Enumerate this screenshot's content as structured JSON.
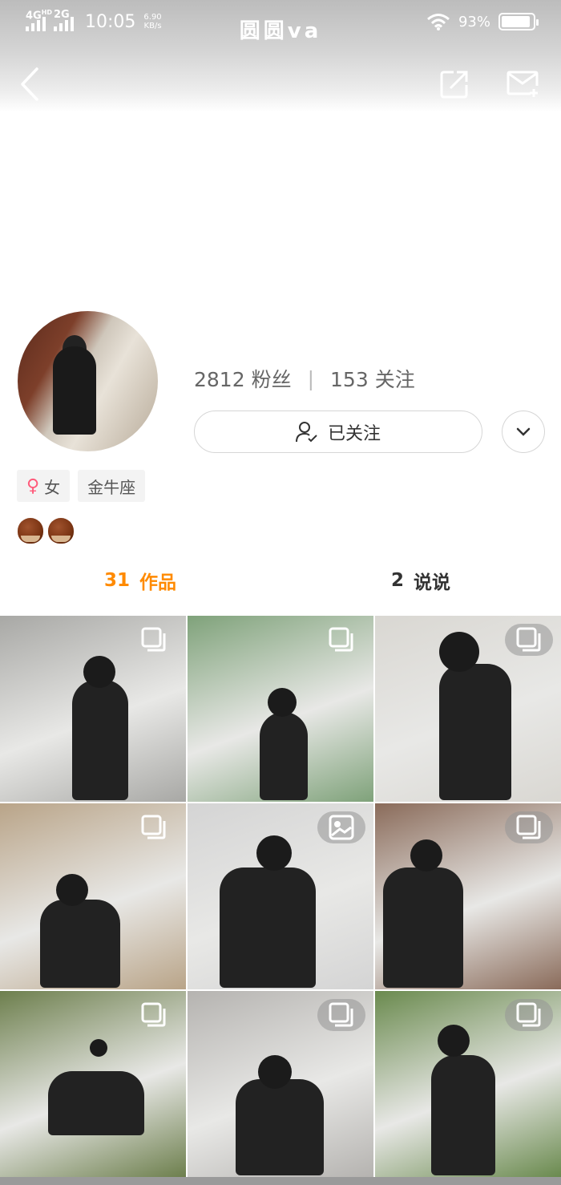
{
  "status_bar": {
    "network_1": "4G",
    "network_1_sup": "HD",
    "network_2": "2G",
    "time": "10:05",
    "speed_value": "6.90",
    "speed_unit": "KB/s",
    "battery": "93%",
    "battery_level": 0.93
  },
  "nav": {
    "title": "圆圆va",
    "back_icon": "chevron-left-icon",
    "share_icon": "share-icon",
    "message_icon": "mail-plus-icon"
  },
  "profile": {
    "fans_count": "2812",
    "fans_label": "粉丝",
    "separator": "|",
    "following_count": "153",
    "following_label": "关注",
    "follow_button_label": "已关注",
    "gender_symbol": "♀",
    "gender_label": "女",
    "zodiac_label": "金牛座",
    "badges": [
      "chestnut",
      "chestnut"
    ]
  },
  "tabs": [
    {
      "count": "31",
      "label": "作品",
      "active": true
    },
    {
      "count": "2",
      "label": "说说",
      "active": false
    }
  ],
  "grid": [
    {
      "bg": "#a8a8a5",
      "badge": "multi-image-icon"
    },
    {
      "bg": "#7fa27a",
      "badge": "multi-image-icon"
    },
    {
      "bg": "#d9d7d2",
      "badge": "multi-image-icon"
    },
    {
      "bg": "#b9a488",
      "badge": "multi-image-icon"
    },
    {
      "bg": "#d4d4d4",
      "badge": "image-icon"
    },
    {
      "bg": "#8a6b5a",
      "badge": "multi-image-icon"
    },
    {
      "bg": "#6d7f4d",
      "badge": "multi-image-icon"
    },
    {
      "bg": "#b5b3b0",
      "badge": "multi-image-icon"
    },
    {
      "bg": "#6a8a4e",
      "badge": "multi-image-icon"
    }
  ]
}
